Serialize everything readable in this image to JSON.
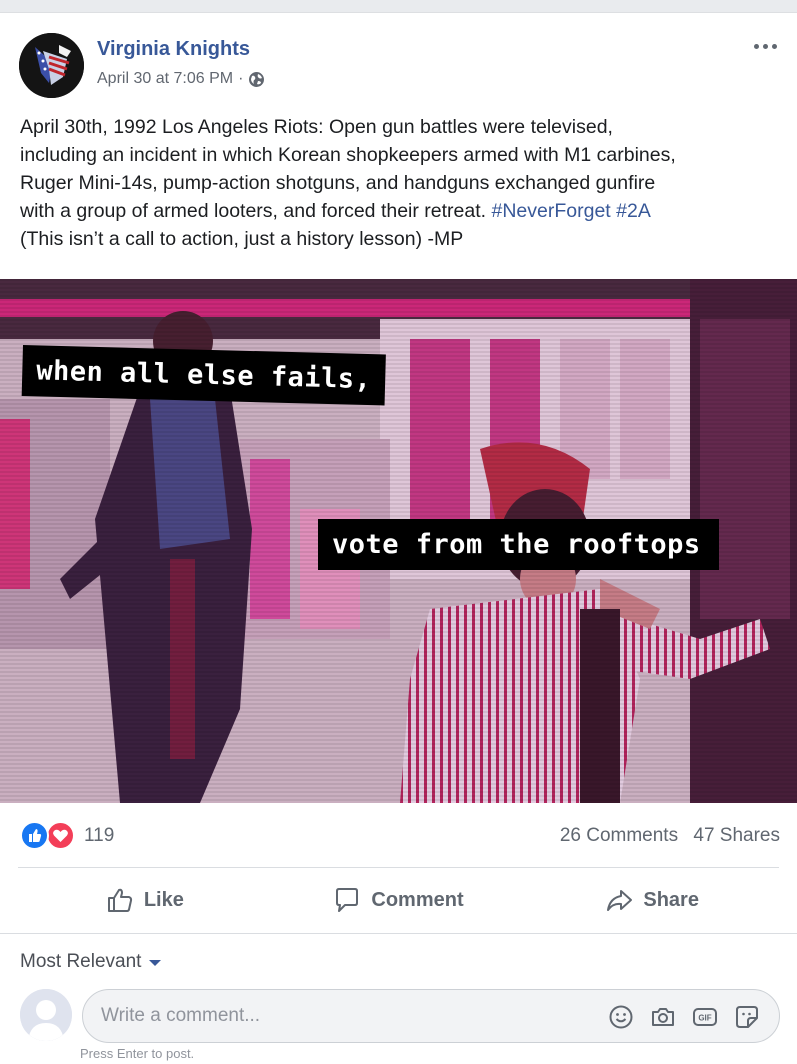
{
  "post": {
    "page_name": "Virginia Knights",
    "timestamp": "April 30 at 7:06 PM",
    "separator": "·",
    "privacy_icon": "globe-icon",
    "more_icon": "more-options-icon",
    "caption_lines": [
      "April 30th, 1992 Los Angeles Riots: Open gun battles were televised,",
      "including an incident in which Korean shopkeepers armed with M1 carbines,",
      "Ruger Mini-14s, pump-action shotguns, and handguns exchanged gunfire",
      "with a group of armed looters, and forced their retreat. "
    ],
    "hashtags": [
      "#NeverForget",
      "#2A"
    ],
    "caption_last": "(This isn’t a call to action, just a history lesson) -MP",
    "image": {
      "text_top": "when all else fails,",
      "text_bottom": "vote from the rooftops"
    }
  },
  "summary": {
    "reaction_icons": [
      "like-reaction-icon",
      "love-reaction-icon"
    ],
    "reaction_count": "119",
    "comments": "26 Comments",
    "shares": "47 Shares"
  },
  "actions": {
    "like": "Like",
    "comment": "Comment",
    "share": "Share"
  },
  "comments": {
    "sort_label": "Most Relevant",
    "input_placeholder": "Write a comment...",
    "tools": [
      "emoji-icon",
      "camera-icon",
      "gif-icon",
      "sticker-icon"
    ],
    "hint": "Press Enter to post."
  },
  "colors": {
    "link_blue": "#385898",
    "like_blue": "#1877f2",
    "love_red": "#f33e58",
    "secondary_text": "#606770"
  }
}
